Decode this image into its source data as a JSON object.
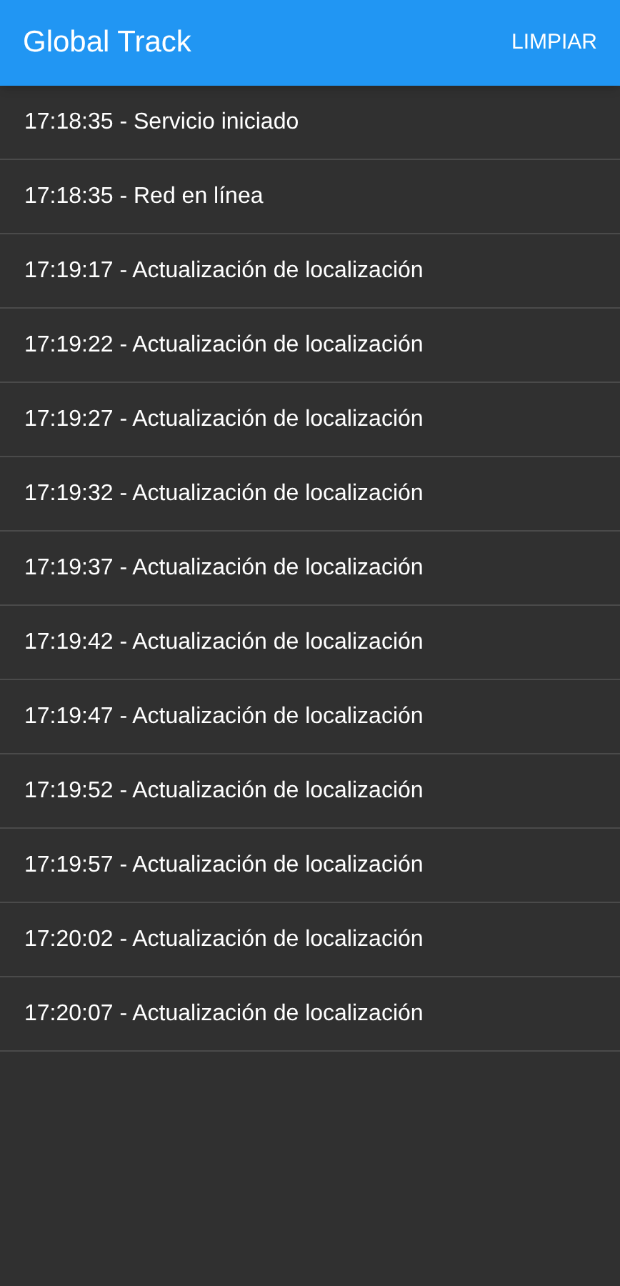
{
  "app_bar": {
    "title": "Global Track",
    "action": "LIMPIAR"
  },
  "log": [
    {
      "text": "17:18:35 - Servicio iniciado"
    },
    {
      "text": "17:18:35 - Red en línea"
    },
    {
      "text": "17:19:17 - Actualización de localización"
    },
    {
      "text": "17:19:22 - Actualización de localización"
    },
    {
      "text": "17:19:27 - Actualización de localización"
    },
    {
      "text": "17:19:32 - Actualización de localización"
    },
    {
      "text": "17:19:37 - Actualización de localización"
    },
    {
      "text": "17:19:42 - Actualización de localización"
    },
    {
      "text": "17:19:47 - Actualización de localización"
    },
    {
      "text": "17:19:52 - Actualización de localización"
    },
    {
      "text": "17:19:57 - Actualización de localización"
    },
    {
      "text": "17:20:02 - Actualización de localización"
    },
    {
      "text": "17:20:07 - Actualización de localización"
    }
  ]
}
